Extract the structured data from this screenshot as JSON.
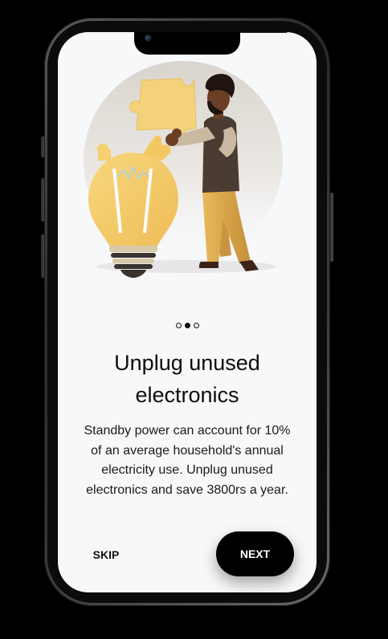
{
  "onboarding": {
    "title_line1": "Unplug unused",
    "title_line2": "electronics",
    "body_line1": "Standby power can account for 10%",
    "body_line2": "of an average household's annual",
    "body_line3": "electricity use. Unplug unused",
    "body_line4": "electronics and save 3800rs a year.",
    "pager": {
      "count": 3,
      "active_index": 1
    }
  },
  "actions": {
    "skip_label": "SKIP",
    "next_label": "NEXT"
  },
  "illustration": {
    "subject": "man-holding-puzzle-piece-lightbulb",
    "colors": {
      "bulb": "#f6cf6e",
      "puzzle": "#f3d27a",
      "trousers": "#d9a64a",
      "vest": "#4a3c33",
      "skin": "#6b3e26",
      "backdrop": "#e4e1dc"
    }
  },
  "colors": {
    "screen_bg": "#f7f8fa",
    "primary_button": "#000000",
    "text": "#0d0d0d"
  }
}
